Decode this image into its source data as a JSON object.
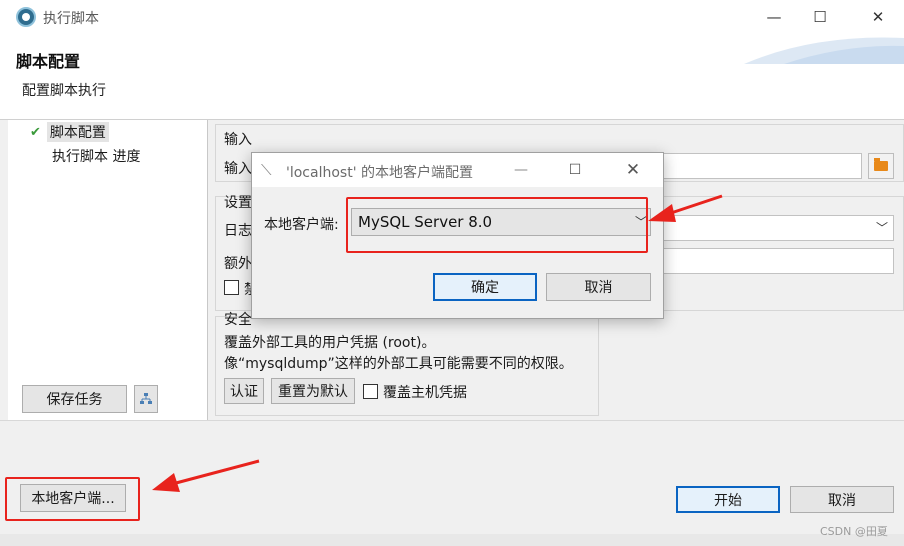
{
  "window": {
    "title": "执行脚本",
    "icon": "dbeaver-icon",
    "controls": {
      "minimize": "—",
      "maximize": "☐",
      "close": "✕"
    }
  },
  "header": {
    "title": "脚本配置",
    "subtitle": "配置脚本执行"
  },
  "sidebar": {
    "items": [
      {
        "label": "脚本配置",
        "checked": true,
        "selected": true
      },
      {
        "label": "执行脚本 进度",
        "checked": false,
        "selected": false
      }
    ],
    "save_task_button": "保存任务",
    "tree_icon": "tree-structure-icon"
  },
  "input_group": {
    "title": "输入",
    "field_label": "输入",
    "folder_icon": "folder-icon"
  },
  "settings_group": {
    "title": "设置",
    "log_label": "日志",
    "extra_label": "额外",
    "checkbox_label": "禁",
    "checkbox_checked": false
  },
  "security_group": {
    "title": "安全",
    "line1": "覆盖外部工具的用户凭据 (root)。",
    "line2": "像“mysqldump”这样的外部工具可能需要不同的权限。",
    "auth_button": "认证",
    "reset_button": "重置为默认",
    "override_checkbox_label": "覆盖主机凭据",
    "override_checked": false
  },
  "footer": {
    "local_client_button": "本地客户端...",
    "start_button": "开始",
    "cancel_button": "取消"
  },
  "dialog": {
    "title": "'localhost' 的本地客户端配置",
    "icon": "dbeaver-icon",
    "controls": {
      "minimize": "—",
      "maximize": "☐",
      "close": "✕"
    },
    "client_label": "本地客户端:",
    "client_value": "MySQL Server 8.0",
    "ok_button": "确定",
    "cancel_button": "取消"
  },
  "watermark": "CSDN @田夏",
  "colors": {
    "annotation_red": "#e8231d",
    "default_button_border": "#0a64c2",
    "check_green": "#3a9a3a",
    "folder_orange": "#e8891a"
  }
}
